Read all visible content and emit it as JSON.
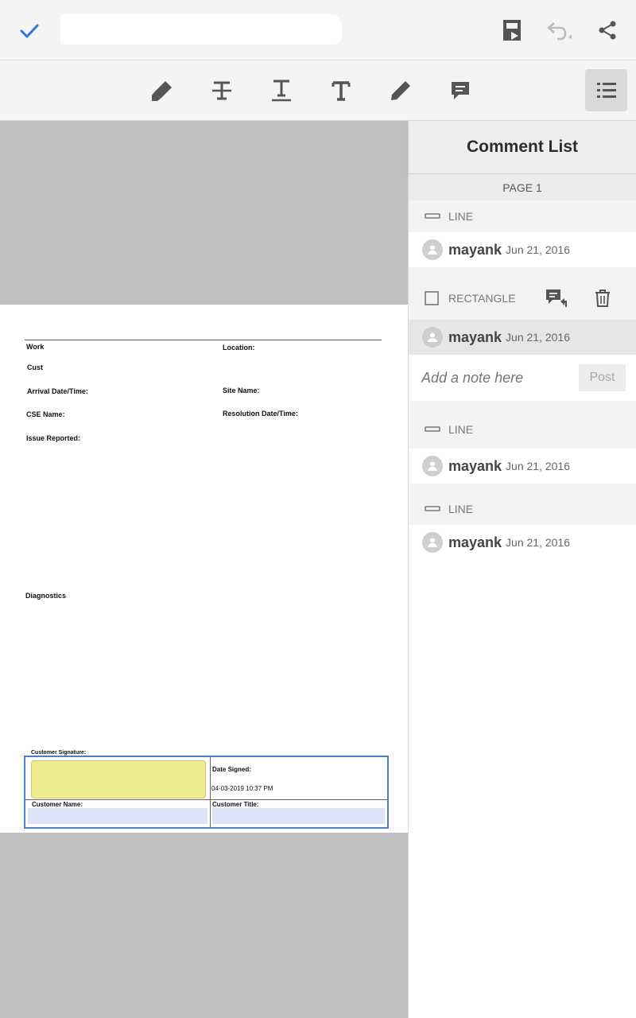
{
  "toolbar": {
    "tools": [
      "highlight-tool",
      "strikethrough-tool",
      "underline-tool",
      "insert-text-tool",
      "draw-tool",
      "comment-tool"
    ]
  },
  "document": {
    "fields": {
      "work": "Work",
      "location": "Location:",
      "cust": "Cust",
      "arrival": "Arrival Date/Time:",
      "site_name": "Site Name:",
      "cse_name": "CSE Name:",
      "resolution": "Resolution Date/Time:",
      "issue": "Issue Reported:",
      "diagnostics": "Diagnostics",
      "customer_signature": "Customer Signature:",
      "date_signed": "Date Signed:",
      "date_signed_value": "04-03-2019 10:37 PM",
      "customer_name": "Customer Name:",
      "customer_title": "Customer Title:"
    }
  },
  "comment_panel": {
    "title": "Comment List",
    "page_label": "PAGE 1",
    "groups": [
      {
        "type": "LINE",
        "author": "mayank",
        "date": "Jun 21, 2016"
      },
      {
        "type": "RECTANGLE",
        "author": "mayank",
        "date": "Jun 21, 2016",
        "selected": true
      },
      {
        "type": "LINE",
        "author": "mayank",
        "date": "Jun 21, 2016"
      },
      {
        "type": "LINE",
        "author": "mayank",
        "date": "Jun 21, 2016"
      }
    ],
    "note_placeholder": "Add a note here",
    "post_label": "Post"
  },
  "colors": {
    "accent": "#2d7ad6",
    "icon": "#555555",
    "highlight_yellow": "#eeeb8f",
    "selection_border": "#4a7fd0"
  }
}
